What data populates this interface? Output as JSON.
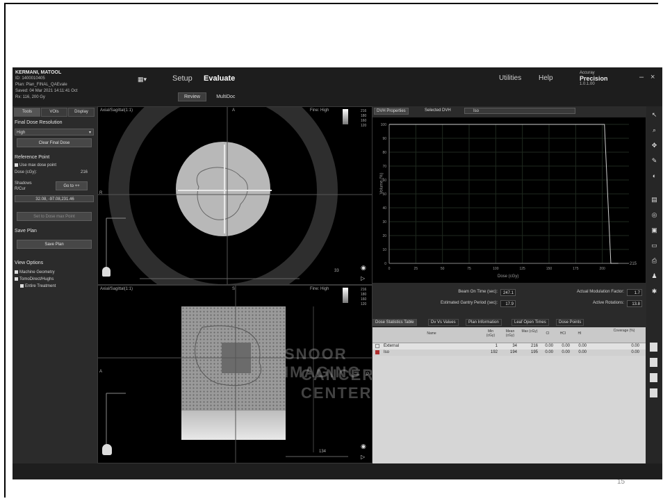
{
  "page_number": "15",
  "patient": {
    "name": "KERMANI, MATOOL",
    "id_line": "ID: 1400010405",
    "plan_line": "Plan: Plan_FINAL_QAEvale",
    "saved_line": "Saved: 04 Mar 2021 14:11:41 Oct",
    "rx_line": "Rx: 116, 200 Gy"
  },
  "menu": {
    "grid_label": "▦▾",
    "setup": "Setup",
    "evaluate": "Evaluate",
    "utilities": "Utilities",
    "help": "Help"
  },
  "subtabs": {
    "review": "Review",
    "multidoc": "MultiDoc"
  },
  "brand": {
    "top": "Accuray",
    "name": "Precision",
    "version": "1.0.1.00"
  },
  "window": {
    "minimize": "–",
    "close": "×"
  },
  "left_panel": {
    "tabs": [
      "Tools",
      "VOIs",
      "Display"
    ],
    "final_dose_heading": "Final Dose Resolution",
    "resolution_value": "High",
    "clear_final_dose": "Clear Final Dose",
    "reference_point_heading": "Reference Point",
    "use_max_dose": "Use max dose point",
    "dose_label": "Dose (cGy):",
    "dose_value": "216",
    "shadows_label": "Shadows",
    "shadows_sub": "R/Cur",
    "go_to": "Go to ++",
    "coords": "32.08, -97.08,231.46",
    "set_to_dose_max": "Set to Dose max Point",
    "save_plan_heading": "Save Plan",
    "save_plan": "Save Plan",
    "view_options_heading": "View Options",
    "machine_geometry": "Machine Geometry",
    "tomodirect": "TomoDirect/Hughs",
    "entire_treatment": "Entire Treatment"
  },
  "viewports": {
    "top_label": "Axial/Sagittal(1:1)",
    "bottom_label": "Axial/Sagittal(1:1)",
    "top_marker": "A",
    "left_marker": "R",
    "right_marker": "L",
    "bottom_marker_p": "P",
    "side_marker_s": "S",
    "top_quality": "Fine: High",
    "bottom_quality": "Fine: High",
    "scale_top": [
      "216",
      "180",
      "160",
      "120"
    ],
    "scale_bottom": [
      "216",
      "180",
      "160",
      "120"
    ],
    "slider_top": "33",
    "slider_bottom": "134"
  },
  "dvh": {
    "tabs": [
      "DVH Properties",
      "Selected DVH"
    ],
    "selected_value": "Iso",
    "y_label": "Volume (%)",
    "x_label": "Dose (cGy)",
    "x_end_label": "215"
  },
  "chart_data": {
    "type": "line",
    "title": "",
    "xlabel": "Dose (cGy)",
    "ylabel": "Volume (%)",
    "xlim": [
      0,
      225
    ],
    "ylim": [
      0,
      100
    ],
    "x_ticks": [
      0,
      25,
      50,
      75,
      100,
      125,
      150,
      175,
      200
    ],
    "y_ticks": [
      0,
      10,
      20,
      30,
      40,
      50,
      60,
      70,
      80,
      90,
      100
    ],
    "series": [
      {
        "color": "#d0d0d0",
        "x": [
          0,
          202,
          208,
          215
        ],
        "y": [
          100,
          100,
          0,
          0
        ]
      }
    ]
  },
  "stats": {
    "beam_on_time_label": "Beam On Time (sec):",
    "beam_on_time": "247.1",
    "gantry_period_label": "Estimated Gantry Period (sec):",
    "gantry_period": "17.9",
    "mod_factor_label": "Actual Modulation Factor:",
    "mod_factor": "1.7",
    "rotations_label": "Active Rotations:",
    "rotations": "13.8"
  },
  "table_tabs": [
    "Dose Statistics Table",
    "Dv Vs Values",
    "Plan Information",
    "Leaf Open Times",
    "Dose Points"
  ],
  "table": {
    "headers": [
      "Name",
      "Min (cGy)",
      "Mean (cGy)",
      "Max (cGy)",
      "CI",
      "HCI",
      "HI",
      "Coverage (%)"
    ],
    "rows": [
      {
        "color": "#ffffff",
        "cells": [
          "External",
          "1",
          "34",
          "216",
          "0.00",
          "0.00",
          "0.00",
          "0.00"
        ]
      },
      {
        "color": "#b03030",
        "cells": [
          "Iso",
          "192",
          "194",
          "195",
          "0.00",
          "0.00",
          "0.00",
          "0.00"
        ]
      }
    ]
  },
  "watermark": {
    "line1": "SNOOR IMAGING",
    "line2": "CANCER CENTER"
  },
  "tools": [
    "arrow-icon",
    "zoom-icon",
    "pan-icon",
    "measure-icon",
    "window-level-icon",
    "report-icon",
    "camera-icon",
    "save-icon",
    "video-icon",
    "print-icon",
    "user-icon",
    "settings-icon",
    "doc-icon",
    "doc-1-icon",
    "doc-2-icon",
    "doc-3-icon"
  ]
}
